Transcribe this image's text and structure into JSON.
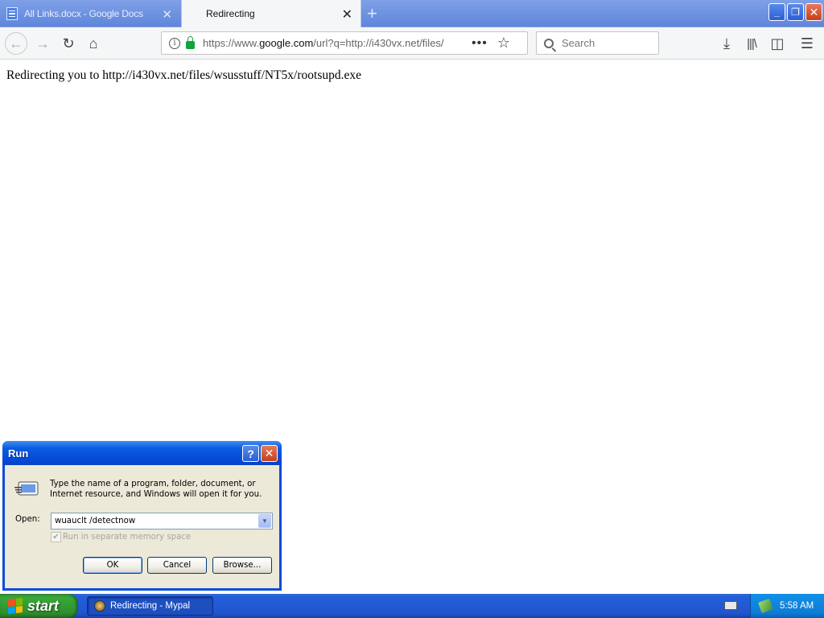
{
  "browser": {
    "tabs": [
      {
        "title": "All Links.docx - Google Docs",
        "active": false
      },
      {
        "title": "Redirecting",
        "active": true
      }
    ],
    "url_prefix": "https://www.",
    "url_domain": "google.com",
    "url_rest": "/url?q=http://i430vx.net/files/",
    "search_placeholder": "Search",
    "page_actions": "•••"
  },
  "page": {
    "message": "Redirecting you to http://i430vx.net/files/wsusstuff/NT5x/rootsupd.exe"
  },
  "run_dialog": {
    "title": "Run",
    "description": "Type the name of a program, folder, document, or Internet resource, and Windows will open it for you.",
    "open_label": "Open:",
    "open_value": "wuauclt /detectnow",
    "checkbox_label": "Run in separate memory space",
    "checkbox_checked": true,
    "ok": "OK",
    "cancel": "Cancel",
    "browse": "Browse..."
  },
  "taskbar": {
    "start": "start",
    "task_label": "Redirecting - Mypal",
    "clock": "5:58 AM"
  },
  "colors": {
    "xp_blue": "#245edb",
    "start_green": "#38a838",
    "tray_blue": "#0c7cd6"
  }
}
